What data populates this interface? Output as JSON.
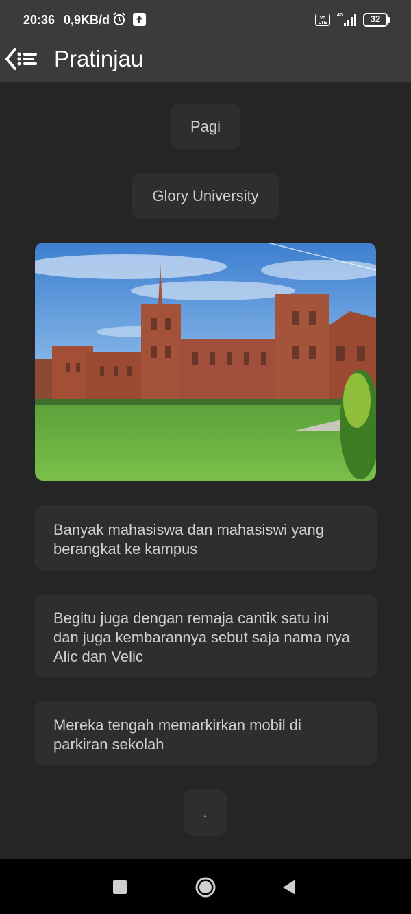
{
  "status": {
    "time": "20:36",
    "speed": "0,9KB/d",
    "network": "4G",
    "volte": "Vo LTE",
    "battery": "32",
    "icons": [
      "alarm-icon",
      "upload-icon",
      "volte-icon",
      "signal-icon",
      "battery-icon"
    ]
  },
  "appbar": {
    "title": "Pratinjau",
    "back_icon": "back-menu-icon"
  },
  "content": {
    "greeting": "Pagi",
    "location": "Glory University",
    "image_alt": "university-building-photo",
    "paragraphs": [
      "Banyak mahasiswa dan mahasiswi yang berangkat ke kampus",
      "Begitu juga dengan remaja cantik satu ini dan juga kembarannya sebut saja nama nya Alic dan Velic",
      "Mereka tengah memarkirkan mobil di parkiran sekolah"
    ],
    "ending": "."
  },
  "colors": {
    "background": "#252525",
    "bar": "#3b3b3b",
    "bubble": "#2e2e2e",
    "text": "#cfcfcf"
  }
}
